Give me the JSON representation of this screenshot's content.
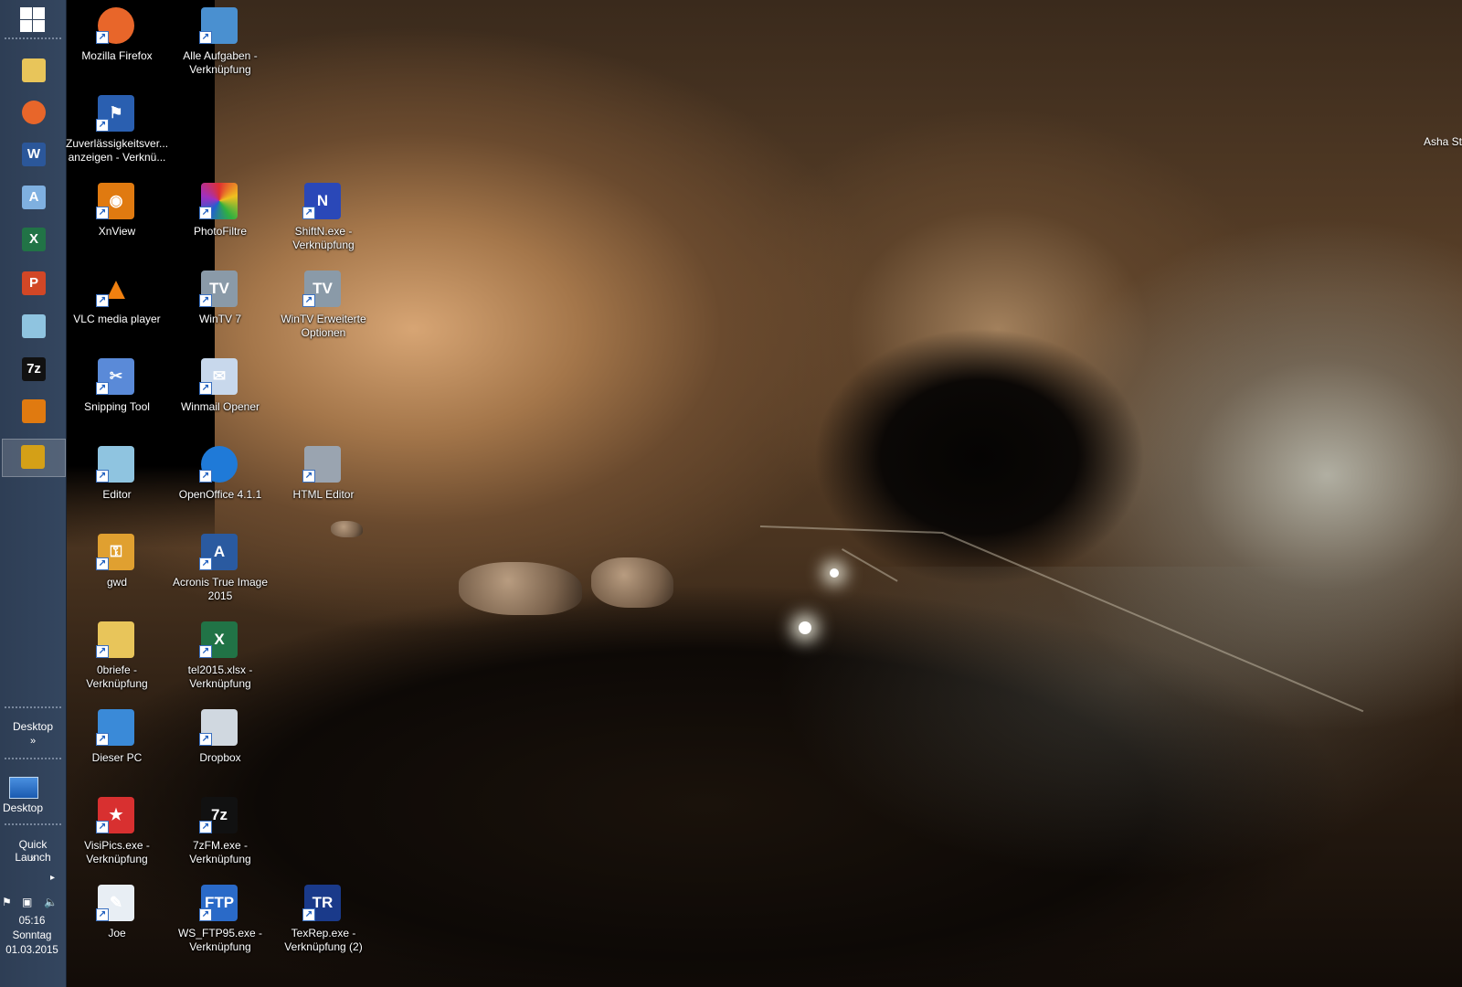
{
  "taskbar": {
    "quick_launch_icons": [
      {
        "name": "file-explorer-icon",
        "color": "#e8c55a"
      },
      {
        "name": "firefox-icon",
        "color": "#e8662a"
      },
      {
        "name": "word-icon",
        "color": "#2b579a",
        "glyph": "W"
      },
      {
        "name": "notepad-word-icon",
        "color": "#7fb0e0",
        "glyph": "A"
      },
      {
        "name": "excel-icon",
        "color": "#217346",
        "glyph": "X"
      },
      {
        "name": "powerpoint-icon",
        "color": "#d24726",
        "glyph": "P"
      },
      {
        "name": "editor-icon",
        "color": "#8fc4e0"
      },
      {
        "name": "sevenzip-icon",
        "color": "#111111",
        "glyph": "7z"
      },
      {
        "name": "xnview-icon",
        "color": "#e07a10"
      },
      {
        "name": "photofiltre-icon",
        "color": "#d4a017"
      }
    ],
    "desktop_toolbar_label": "Desktop",
    "desktop_button_label": "Desktop",
    "quick_launch_label": "Quick Launch",
    "chevron": "»",
    "arrow": "▸",
    "clock": {
      "time": "05:16",
      "day": "Sonntag",
      "date": "01.03.2015"
    }
  },
  "desktop": {
    "icons": [
      {
        "id": "firefox",
        "label": "Mozilla Firefox",
        "icon": "firefox-icon",
        "color": "#e8662a",
        "glyph": ""
      },
      {
        "id": "alle-aufgaben",
        "label": "Alle Aufgaben - Verknüpfung",
        "icon": "control-panel-icon",
        "color": "#4a90d0",
        "glyph": ""
      },
      {
        "id": "zuverlaessigkeit",
        "label": "Zuverlässigkeitsver... anzeigen - Verknü...",
        "icon": "flag-icon",
        "color": "#2a5fb0",
        "glyph": "⚑"
      },
      {
        "id": "xnview",
        "label": "XnView",
        "icon": "xnview-icon",
        "color": "#e07a10",
        "glyph": "◉"
      },
      {
        "id": "photofiltre",
        "label": "PhotoFiltre",
        "icon": "photofiltre-icon",
        "color": "#2c9c3a",
        "glyph": ""
      },
      {
        "id": "shiftn",
        "label": "ShiftN.exe - Verknüpfung",
        "icon": "shiftn-icon",
        "color": "#2a48b8",
        "glyph": "N"
      },
      {
        "id": "vlc",
        "label": "VLC media player",
        "icon": "vlc-cone-icon",
        "color": "#f08010",
        "glyph": "▲"
      },
      {
        "id": "wintv7",
        "label": "WinTV 7",
        "icon": "wintv-icon",
        "color": "#8a9aa8",
        "glyph": "TV"
      },
      {
        "id": "wintv-erweitert",
        "label": "WinTV Erweiterte Optionen",
        "icon": "wintv-icon",
        "color": "#8a9aa8",
        "glyph": "TV"
      },
      {
        "id": "snipping",
        "label": "Snipping Tool",
        "icon": "scissors-icon",
        "color": "#5a8ad8",
        "glyph": "✂"
      },
      {
        "id": "winmail",
        "label": "Winmail Opener",
        "icon": "envelope-icon",
        "color": "#c8d8ec",
        "glyph": "✉"
      },
      {
        "id": "editor",
        "label": "Editor",
        "icon": "notepad-icon",
        "color": "#8fc4e0",
        "glyph": ""
      },
      {
        "id": "openoffice",
        "label": "OpenOffice 4.1.1",
        "icon": "openoffice-icon",
        "color": "#1f7ad8",
        "glyph": ""
      },
      {
        "id": "html-editor",
        "label": "HTML Editor",
        "icon": "html-editor-icon",
        "color": "#9aa4b0",
        "glyph": ""
      },
      {
        "id": "gwd",
        "label": "gwd",
        "icon": "key-icon",
        "color": "#e0a030",
        "glyph": "⚿"
      },
      {
        "id": "acronis",
        "label": "Acronis True Image 2015",
        "icon": "acronis-icon",
        "color": "#2a5aa0",
        "glyph": "A"
      },
      {
        "id": "0briefe",
        "label": "0briefe - Verknüpfung",
        "icon": "folder-icon",
        "color": "#e8c55a",
        "glyph": ""
      },
      {
        "id": "tel2015",
        "label": "tel2015.xlsx - Verknüpfung",
        "icon": "excel-file-icon",
        "color": "#217346",
        "glyph": "X"
      },
      {
        "id": "dieser-pc",
        "label": "Dieser PC",
        "icon": "computer-icon",
        "color": "#3a8ad8",
        "glyph": ""
      },
      {
        "id": "dropbox",
        "label": "Dropbox",
        "icon": "dropbox-folder-icon",
        "color": "#d0d8e0",
        "glyph": ""
      },
      {
        "id": "visipics",
        "label": "VisiPics.exe - Verknüpfung",
        "icon": "visipics-fox-icon",
        "color": "#d83030",
        "glyph": "★"
      },
      {
        "id": "7zfm",
        "label": "7zFM.exe - Verknüpfung",
        "icon": "sevenzip-icon",
        "color": "#111111",
        "glyph": "7z"
      },
      {
        "id": "joe",
        "label": "Joe",
        "icon": "joe-editor-icon",
        "color": "#e8eef4",
        "glyph": "✎"
      },
      {
        "id": "wsftp",
        "label": "WS_FTP95.exe - Verknüpfung",
        "icon": "ftp-icon",
        "color": "#2a6ac8",
        "glyph": "FTP"
      },
      {
        "id": "texrep",
        "label": "TexRep.exe - Verknüpfung (2)",
        "icon": "texrep-icon",
        "color": "#1a3a8a",
        "glyph": "TR"
      }
    ],
    "edge_label": "Asha St"
  }
}
